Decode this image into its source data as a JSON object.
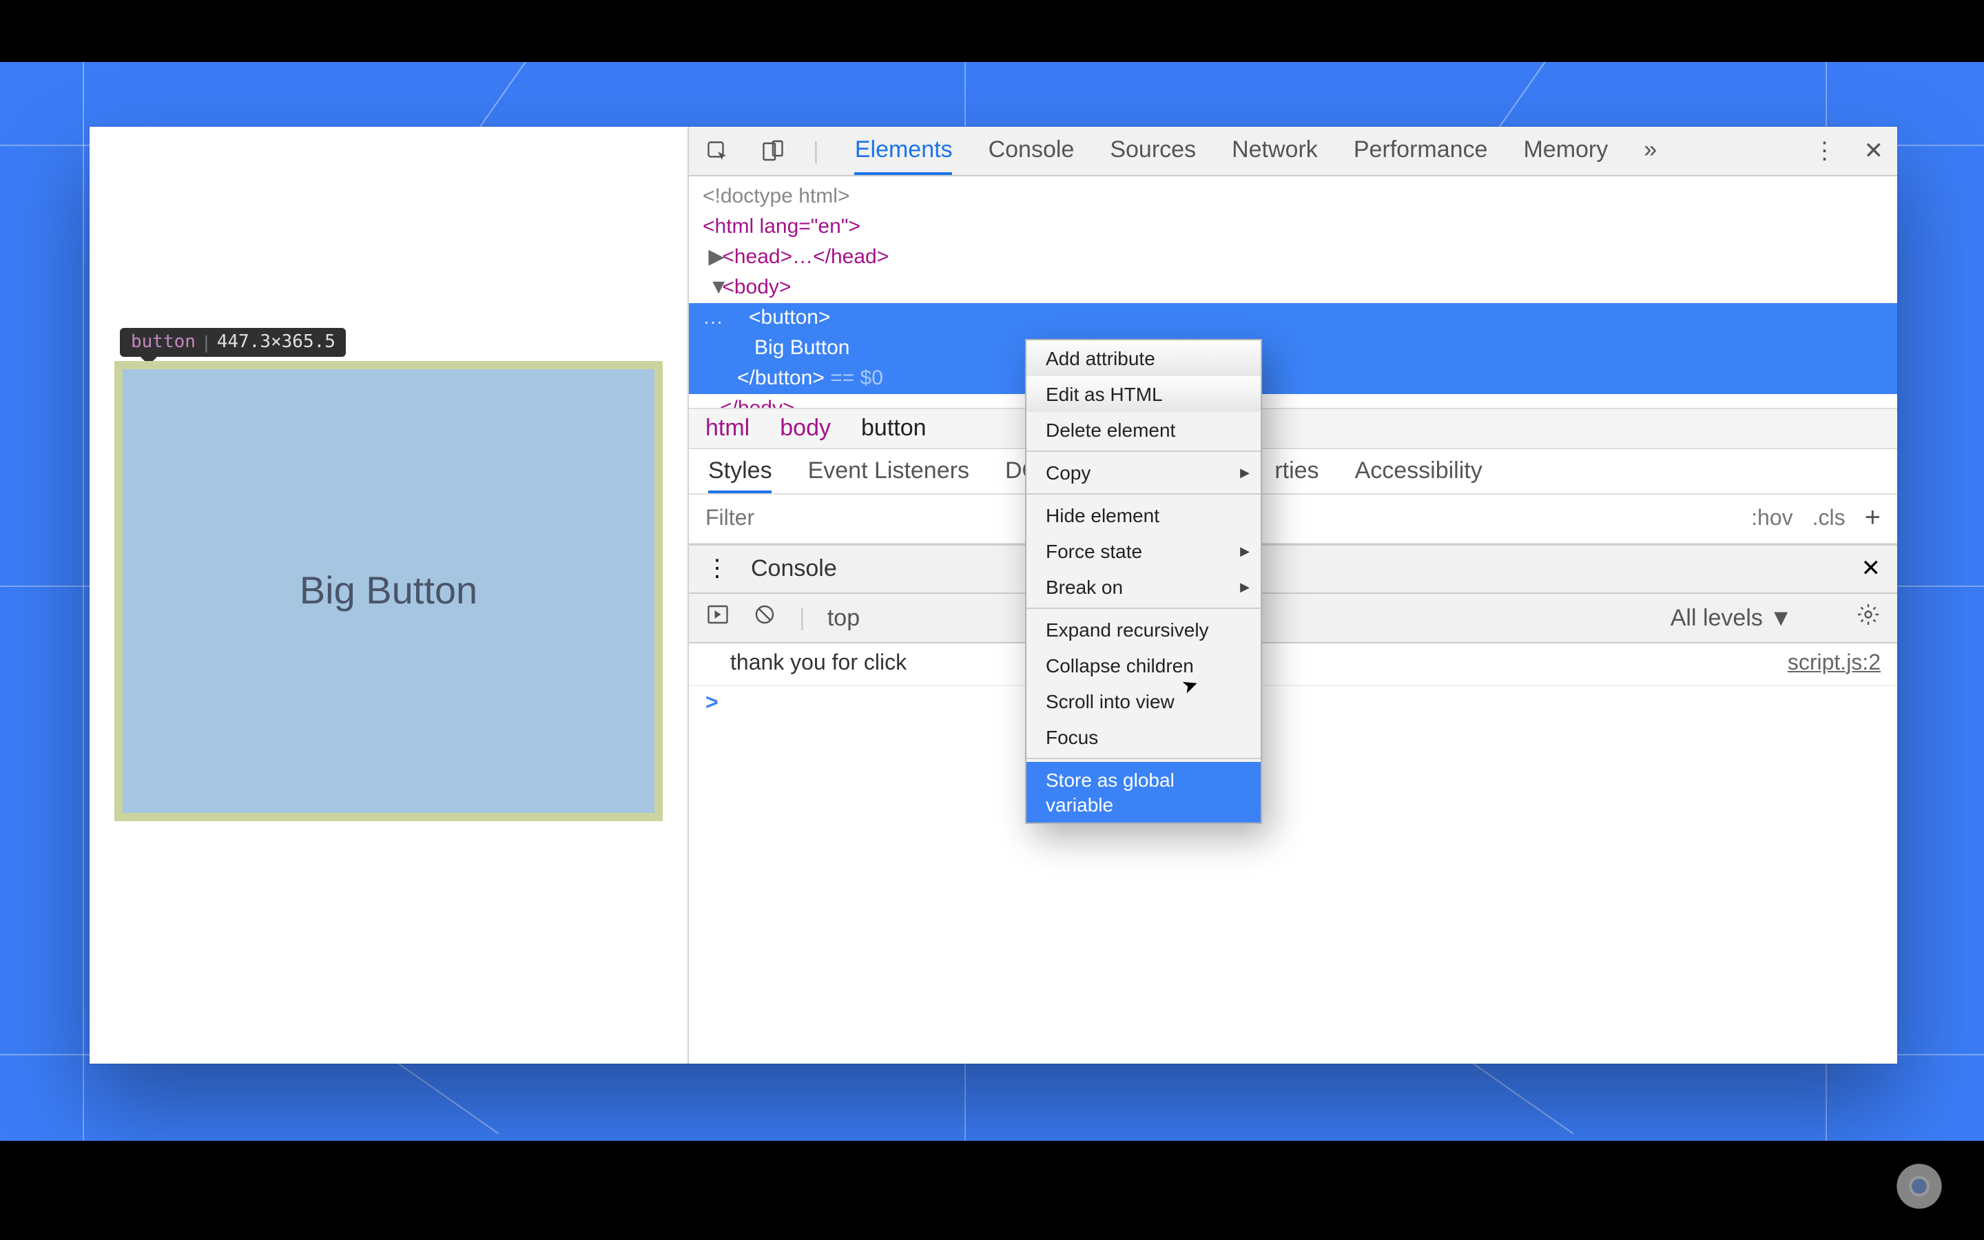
{
  "colors": {
    "accent": "#1a73e8",
    "selection": "#3b82f6",
    "button_fill": "#a6c5e1",
    "button_border": "#cbd49f"
  },
  "page": {
    "hovered_tag": "button",
    "hovered_dims": "447.3×365.5",
    "big_button_label": "Big Button"
  },
  "devtools": {
    "tabs": [
      "Elements",
      "Console",
      "Sources",
      "Network",
      "Performance",
      "Memory"
    ],
    "active_tab": "Elements",
    "overflow": "»",
    "dom_lines": {
      "doctype": "<!doctype html>",
      "html_open": "<html lang=\"en\">",
      "head": "<head>…</head>",
      "body_open": "<body>",
      "button_open": "<button>",
      "button_text": "Big Button",
      "button_close": "</button>",
      "eq0": "== $0",
      "body_close": "</body>"
    },
    "breadcrumbs": [
      "html",
      "body",
      "button"
    ],
    "styles_tabs": [
      "Styles",
      "Event Listeners",
      "DOM Breakpoints",
      "Properties",
      "Accessibility"
    ],
    "styles_active": "Styles",
    "filter_placeholder": "Filter",
    "filter_right": {
      "hov": ":hov",
      "cls": ".cls",
      "plus": "+"
    }
  },
  "context_menu": {
    "groups": [
      [
        "Add attribute",
        "Edit as HTML",
        "Delete element"
      ],
      [
        "Copy"
      ],
      [
        "Hide element",
        "Force state",
        "Break on"
      ],
      [
        "Expand recursively",
        "Collapse children",
        "Scroll into view",
        "Focus"
      ],
      [
        "Store as global variable"
      ]
    ],
    "submenu_items": [
      "Copy",
      "Force state",
      "Break on"
    ],
    "highlighted": "Store as global variable"
  },
  "console": {
    "drawer_title": "Console",
    "context": "top",
    "levels": "All levels ▼",
    "log_text": "thank you for click",
    "log_source": "script.js:2",
    "prompt": ">"
  }
}
